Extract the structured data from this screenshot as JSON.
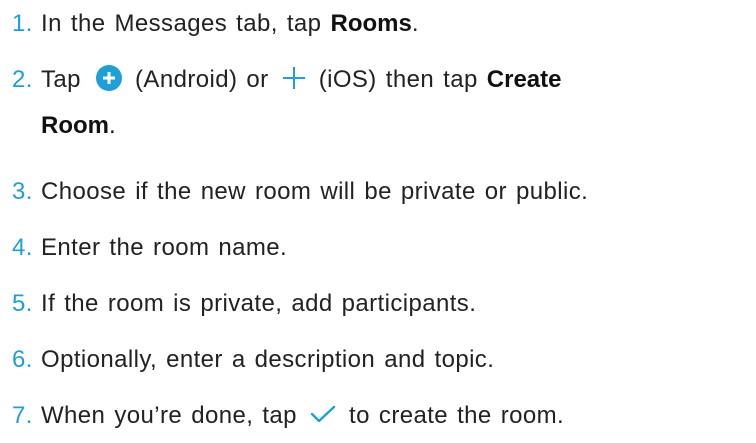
{
  "steps": [
    {
      "num": "1.",
      "text_before": "In the Messages tab, tap ",
      "bold": "Rooms",
      "text_after": "."
    },
    {
      "num": "2.",
      "text_a": "Tap ",
      "text_b": " (Android) or ",
      "text_c": " (iOS) then tap ",
      "bold_line1": "Create",
      "bold_line2": "Room",
      "text_after": ".",
      "icons": [
        "plus-circle-icon",
        "plus-icon"
      ]
    },
    {
      "num": "3.",
      "text": "Choose if the new room will be private or public."
    },
    {
      "num": "4.",
      "text": "Enter the room name."
    },
    {
      "num": "5.",
      "text": "If the room is private, add participants."
    },
    {
      "num": "6.",
      "text": "Optionally, enter a description and topic."
    },
    {
      "num": "7.",
      "text_before": "When you’re done, tap ",
      "text_after": " to create the room.",
      "icon": "checkmark-icon"
    }
  ],
  "colors": {
    "accent": "#1e9fd7",
    "text": "#222222"
  }
}
